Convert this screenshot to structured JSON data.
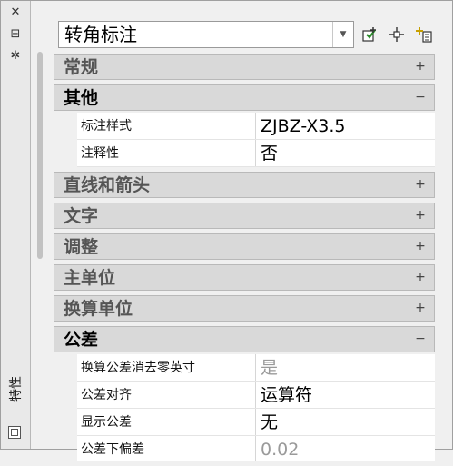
{
  "strip": {
    "close_glyph": "✕",
    "autohide_glyph": "⊟",
    "settings_glyph": "✲",
    "title": "特性"
  },
  "selector": {
    "value": "转角标注"
  },
  "toolbar": {
    "icons": [
      "quick-select-icon",
      "select-objects-icon",
      "toggle-pickadd-icon"
    ]
  },
  "categories": [
    {
      "label": "常规",
      "state": "collapsed"
    },
    {
      "label": "其他",
      "state": "expanded",
      "rows": [
        {
          "key": "标注样式",
          "value": "ZJBZ-X3.5"
        },
        {
          "key": "注释性",
          "value": "否"
        }
      ]
    },
    {
      "label": "直线和箭头",
      "state": "collapsed"
    },
    {
      "label": "文字",
      "state": "collapsed"
    },
    {
      "label": "调整",
      "state": "collapsed"
    },
    {
      "label": "主单位",
      "state": "collapsed"
    },
    {
      "label": "换算单位",
      "state": "collapsed"
    },
    {
      "label": "公差",
      "state": "expanded",
      "rows": [
        {
          "key": "换算公差消去零英寸",
          "value": "是",
          "dim": true
        },
        {
          "key": "公差对齐",
          "value": "运算符"
        },
        {
          "key": "显示公差",
          "value": "无"
        },
        {
          "key": "公差下偏差",
          "value": "0.02",
          "dim": true
        }
      ]
    }
  ],
  "toggles": {
    "expand": "+",
    "collapse": "−"
  }
}
